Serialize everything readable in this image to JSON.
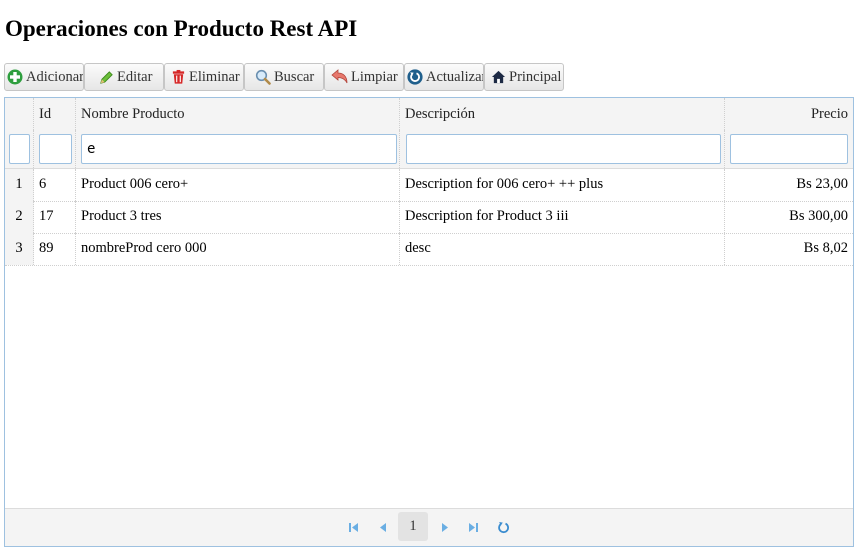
{
  "page": {
    "title": "Operaciones con Producto Rest API"
  },
  "toolbar": {
    "add": "Adicionar",
    "edit": "Editar",
    "delete": "Eliminar",
    "search": "Buscar",
    "clear": "Limpiar",
    "refresh": "Actualizar",
    "home": "Principal"
  },
  "grid": {
    "columns": {
      "rownum": "",
      "id": "Id",
      "name": "Nombre Producto",
      "description": "Descripción",
      "price": "Precio"
    },
    "filters": {
      "id": "",
      "name": "e",
      "description": "",
      "price": ""
    },
    "rows": [
      {
        "num": "1",
        "id": "6",
        "name": "Product 006 cero+",
        "description": "Description for 006 cero+ ++ plus",
        "price": "Bs 23,00"
      },
      {
        "num": "2",
        "id": "17",
        "name": "Product 3 tres",
        "description": "Description for Product 3 iii",
        "price": "Bs 300,00"
      },
      {
        "num": "3",
        "id": "89",
        "name": "nombreProd cero 000",
        "description": "desc",
        "price": "Bs 8,02"
      }
    ]
  },
  "pager": {
    "page": "1",
    "icons": [
      "first-page-icon",
      "prev-page-icon",
      "next-page-icon",
      "last-page-icon",
      "reload-icon"
    ]
  }
}
